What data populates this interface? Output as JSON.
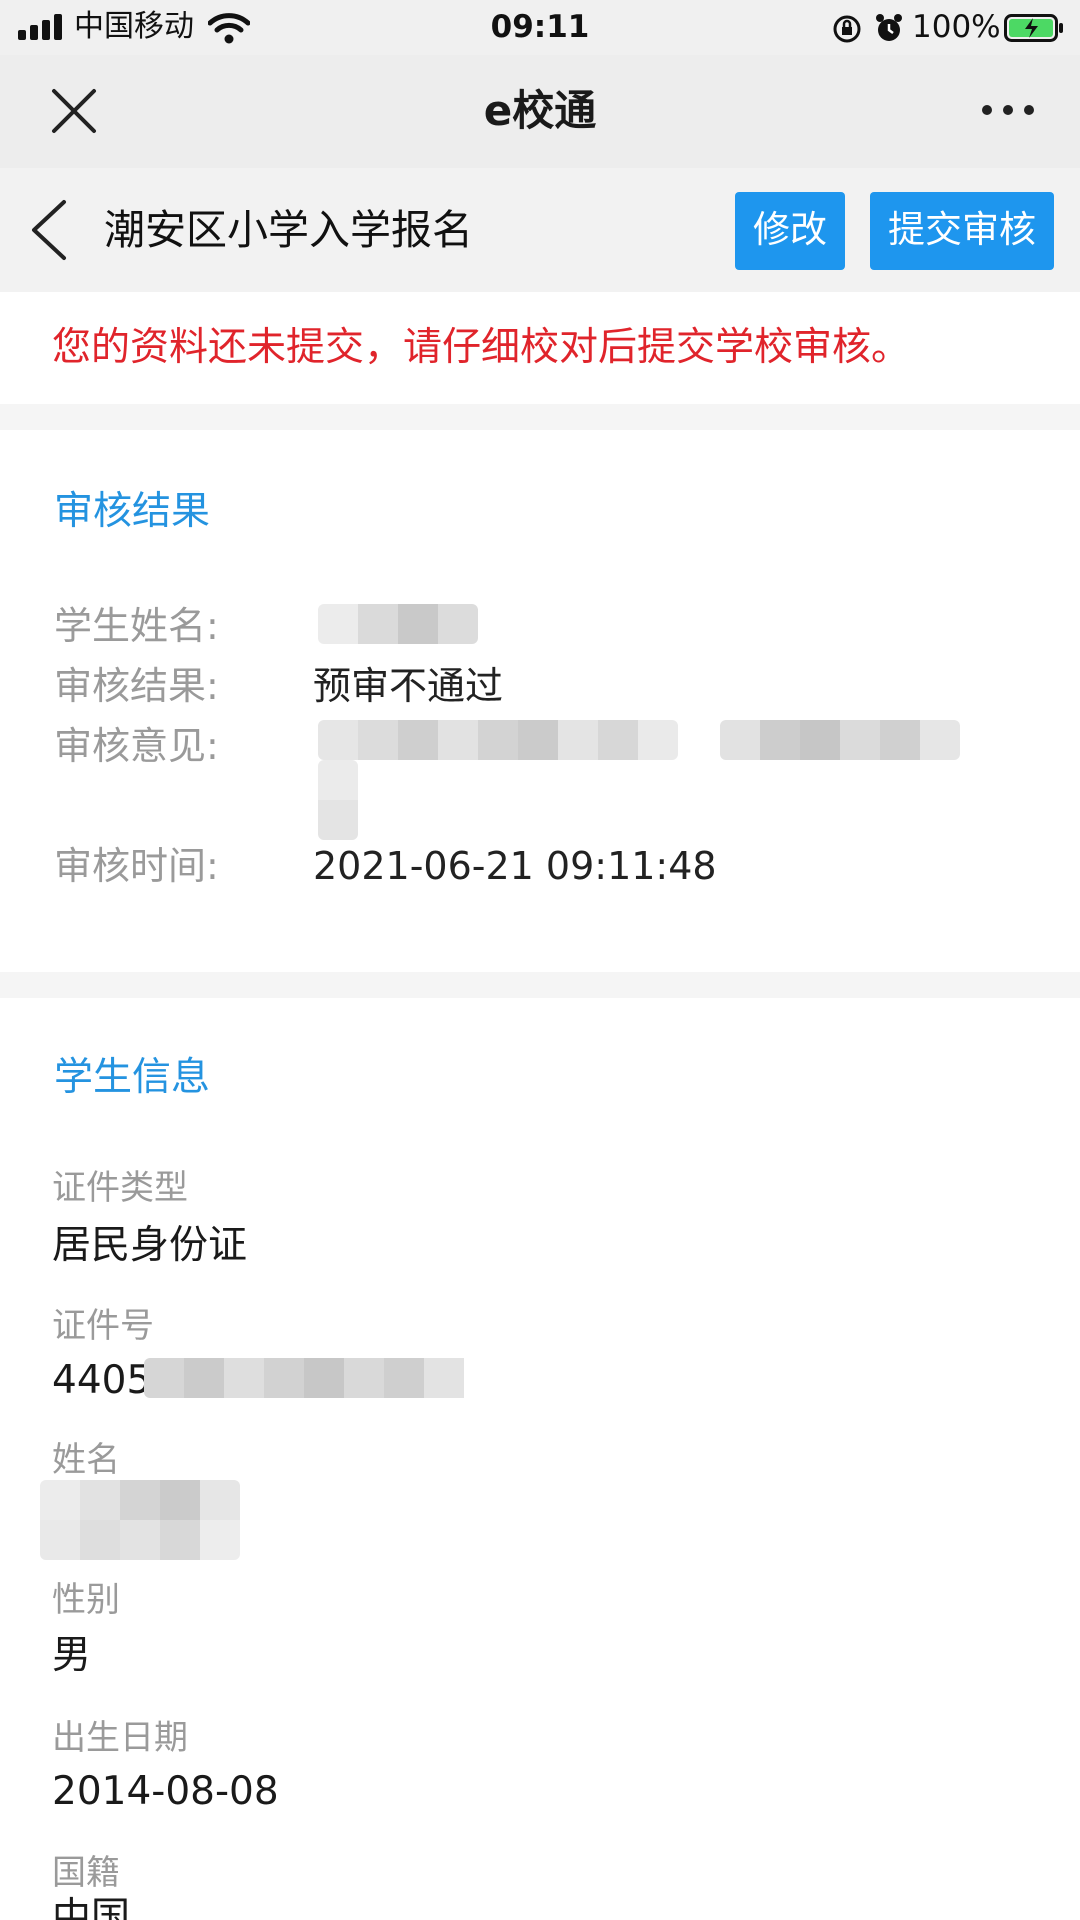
{
  "status_bar": {
    "carrier": "中国移动",
    "time": "09:11",
    "battery": "100%",
    "icons": [
      "signal-icon",
      "wifi-icon",
      "rotation-lock-icon",
      "alarm-icon",
      "battery-charging-icon"
    ]
  },
  "nav": {
    "title": "e校通",
    "icons": [
      "close-icon",
      "more-icon"
    ]
  },
  "header": {
    "title": "潮安区小学入学报名",
    "edit_label": "修改",
    "submit_label": "提交审核",
    "accent_color": "#1e96ee"
  },
  "notice": {
    "text": "您的资料还未提交，请仔细校对后提交学校审核。",
    "color": "#e0242b"
  },
  "review": {
    "title": "审核结果",
    "rows": [
      {
        "label": "学生姓名:",
        "value": ""
      },
      {
        "label": "审核结果:",
        "value": "预审不通过"
      },
      {
        "label": "审核意见:",
        "value": ""
      },
      {
        "label": "审核时间:",
        "value": "2021-06-21 09:11:48"
      }
    ]
  },
  "student": {
    "title": "学生信息",
    "fields": [
      {
        "label": "证件类型",
        "value": "居民身份证"
      },
      {
        "label": "证件号",
        "value": "4405"
      },
      {
        "label": "姓名",
        "value": ""
      },
      {
        "label": "性别",
        "value": "男"
      },
      {
        "label": "出生日期",
        "value": "2014-08-08"
      },
      {
        "label": "国籍",
        "value": "中国"
      }
    ]
  }
}
